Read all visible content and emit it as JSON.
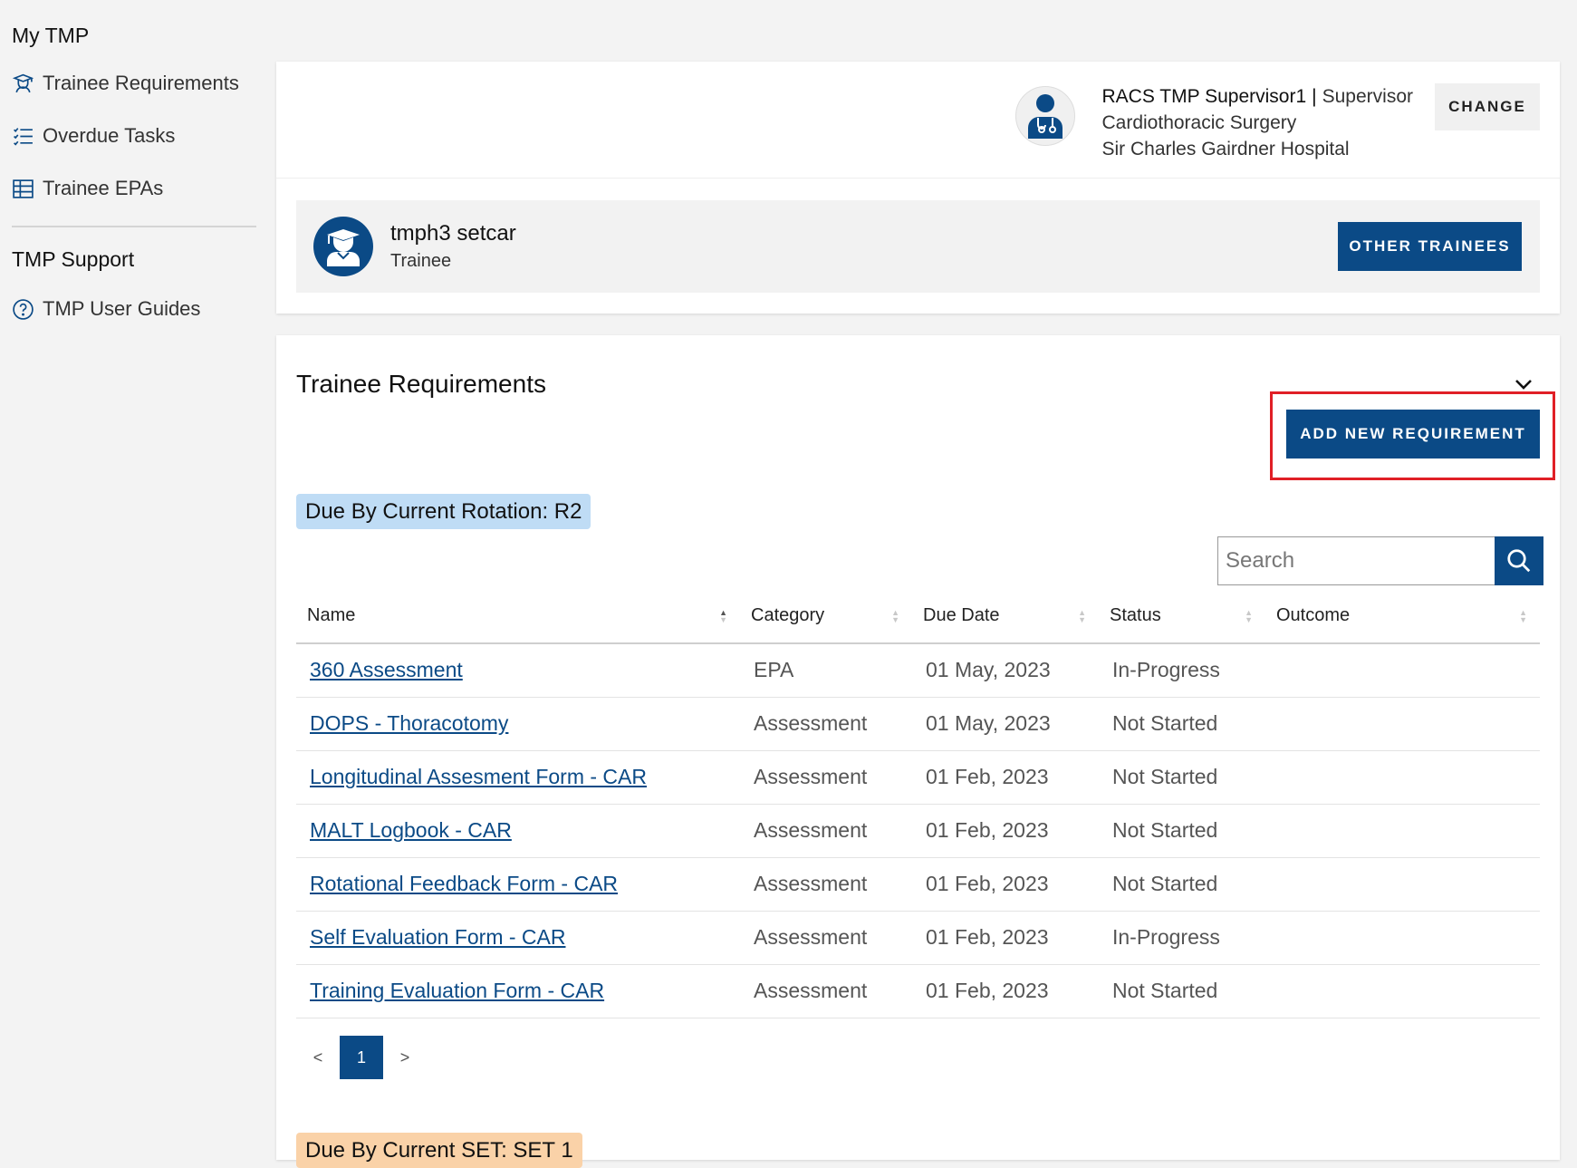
{
  "sidebar": {
    "heading": "My TMP",
    "items": [
      {
        "label": "Trainee Requirements",
        "icon": "trainee-icon"
      },
      {
        "label": "Overdue Tasks",
        "icon": "checklist-icon"
      },
      {
        "label": "Trainee EPAs",
        "icon": "table-icon"
      }
    ],
    "support_heading": "TMP Support",
    "support_items": [
      {
        "label": "TMP User Guides",
        "icon": "help-circle-icon"
      }
    ]
  },
  "supervisor": {
    "name": "RACS TMP Supervisor1",
    "separator": "|",
    "role": "Supervisor",
    "specialty": "Cardiothoracic Surgery",
    "hospital": "Sir Charles Gairdner Hospital",
    "change_label": "CHANGE"
  },
  "trainee": {
    "name": "tmph3 setcar",
    "role": "Trainee",
    "other_label": "OTHER TRAINEES"
  },
  "requirements": {
    "title": "Trainee Requirements",
    "add_label": "ADD NEW REQUIREMENT",
    "rotation_badge": "Due By Current Rotation:  R2",
    "set_badge": "Due By Current SET:  SET 1",
    "search_placeholder": "Search",
    "columns": [
      "Name",
      "Category",
      "Due Date",
      "Status",
      "Outcome"
    ],
    "rows": [
      {
        "name": "360 Assessment",
        "category": "EPA",
        "due": "01 May, 2023",
        "status": "In-Progress",
        "outcome": ""
      },
      {
        "name": "DOPS - Thoracotomy",
        "category": "Assessment",
        "due": "01 May, 2023",
        "status": "Not Started",
        "outcome": ""
      },
      {
        "name": "Longitudinal Assesment Form - CAR",
        "category": "Assessment",
        "due": "01 Feb, 2023",
        "status": "Not Started",
        "outcome": ""
      },
      {
        "name": "MALT Logbook - CAR",
        "category": "Assessment",
        "due": "01 Feb, 2023",
        "status": "Not Started",
        "outcome": ""
      },
      {
        "name": "Rotational Feedback Form - CAR",
        "category": "Assessment",
        "due": "01 Feb, 2023",
        "status": "Not Started",
        "outcome": ""
      },
      {
        "name": "Self Evaluation Form - CAR",
        "category": "Assessment",
        "due": "01 Feb, 2023",
        "status": "In-Progress",
        "outcome": ""
      },
      {
        "name": "Training Evaluation Form - CAR",
        "category": "Assessment",
        "due": "01 Feb, 2023",
        "status": "Not Started",
        "outcome": ""
      }
    ],
    "pager": {
      "prev": "<",
      "page": "1",
      "next": ">"
    }
  },
  "colors": {
    "primary": "#0b4a86",
    "highlight": "#e01f26",
    "rotation_badge": "#bfdcf5",
    "set_badge": "#fad2a8"
  }
}
